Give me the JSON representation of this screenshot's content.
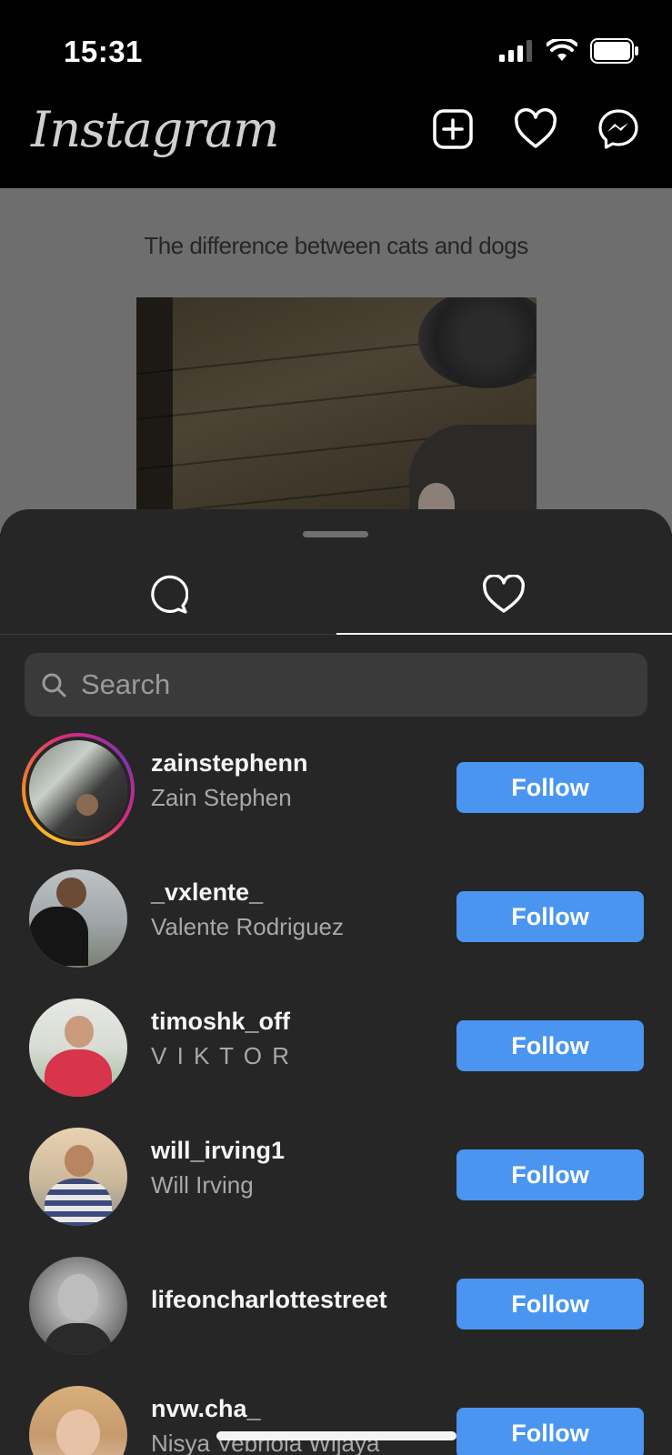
{
  "status_bar": {
    "time": "15:31"
  },
  "header": {
    "logo": "Instagram"
  },
  "post": {
    "caption": "The difference between cats and dogs"
  },
  "sheet": {
    "tabs": [
      {
        "icon": "comment-icon",
        "active": false
      },
      {
        "icon": "heart-icon",
        "active": true
      }
    ],
    "search": {
      "placeholder": "Search",
      "value": ""
    },
    "follow_label": "Follow",
    "users": [
      {
        "username": "zainstephenn",
        "full_name": "Zain Stephen",
        "has_story": true
      },
      {
        "username": "_vxlente_",
        "full_name": "Valente Rodriguez",
        "has_story": false
      },
      {
        "username": "timoshk_off",
        "full_name": "V I K T O R",
        "has_story": false
      },
      {
        "username": "will_irving1",
        "full_name": "Will Irving",
        "has_story": false
      },
      {
        "username": "lifeoncharlottestreet",
        "full_name": "",
        "has_story": false
      },
      {
        "username": "nvw.cha_",
        "full_name": "Nisya Vebriola Wijaya",
        "has_story": false
      }
    ]
  },
  "colors": {
    "follow_button": "#4a95f0",
    "sheet_bg": "#262626",
    "search_bg": "#3a3a3a"
  }
}
